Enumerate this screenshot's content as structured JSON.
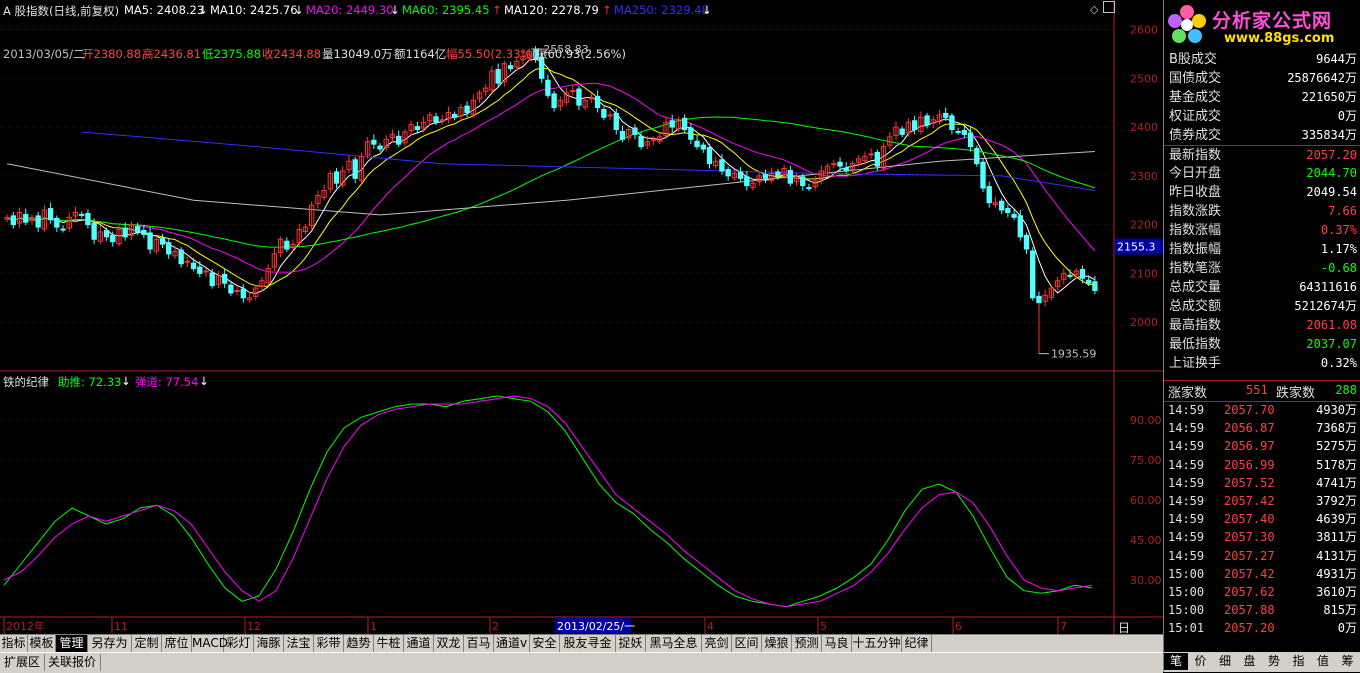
{
  "chart_title": "A 股指数(日线,前复权)",
  "ma_legend": [
    {
      "label": "MA5: 2408.23",
      "color": "#ffffff",
      "arrow": "↓",
      "arrow_color": "#ffffff"
    },
    {
      "label": "MA10: 2425.76",
      "color": "#ffffff",
      "arrow": "↓",
      "arrow_color": "#ffffff"
    },
    {
      "label": "MA20: 2449.30",
      "color": "#ff00ff",
      "arrow": "↓",
      "arrow_color": "#ffffff"
    },
    {
      "label": "MA60: 2395.45",
      "color": "#00ff00",
      "arrow": "↑",
      "arrow_color": "#ff3030"
    },
    {
      "label": "MA120: 2278.79",
      "color": "#ffffff",
      "arrow": "↑",
      "arrow_color": "#ff3030"
    },
    {
      "label": "MA250: 2329.48",
      "color": "#3030ff",
      "arrow": "↓",
      "arrow_color": "#ffffff"
    }
  ],
  "ohlc_info": {
    "date": "2013/03/05/二",
    "open": "开2380.88",
    "high": "高2436.81",
    "low": "低2375.88",
    "close": "收2434.88",
    "volume": "量13049.0万",
    "amount": "额1164亿",
    "change": "幅55.50(2.33%)",
    "amplitude": "振60.93(2.56%)"
  },
  "chart_data": [
    {
      "type": "candlestick",
      "title": "",
      "y_ticks": [
        2000,
        2100,
        2200,
        2300,
        2400,
        2500,
        2600
      ],
      "ylim": [
        1900,
        2640
      ],
      "x_ticks": [
        "2012年",
        "11",
        "12",
        "1",
        "2",
        "3",
        "4",
        "5",
        "6",
        "7"
      ],
      "current_price_label": "2155.3",
      "annotations": [
        {
          "text": "2558.83",
          "kind": "high"
        },
        {
          "text": "1935.59",
          "kind": "low"
        }
      ],
      "closes": [
        2215,
        2200,
        2225,
        2205,
        2215,
        2195,
        2230,
        2210,
        2195,
        2190,
        2215,
        2225,
        2220,
        2200,
        2170,
        2185,
        2175,
        2165,
        2190,
        2175,
        2200,
        2185,
        2180,
        2150,
        2170,
        2160,
        2140,
        2145,
        2120,
        2125,
        2110,
        2100,
        2105,
        2075,
        2095,
        2080,
        2060,
        2065,
        2050,
        2050,
        2070,
        2085,
        2110,
        2140,
        2170,
        2150,
        2160,
        2190,
        2195,
        2240,
        2260,
        2270,
        2305,
        2285,
        2310,
        2330,
        2295,
        2340,
        2370,
        2365,
        2355,
        2375,
        2385,
        2365,
        2390,
        2405,
        2395,
        2410,
        2425,
        2410,
        2415,
        2430,
        2420,
        2440,
        2430,
        2455,
        2470,
        2480,
        2515,
        2490,
        2530,
        2520,
        2535,
        2545,
        2555,
        2540,
        2500,
        2465,
        2440,
        2455,
        2470,
        2475,
        2445,
        2455,
        2460,
        2440,
        2420,
        2425,
        2395,
        2375,
        2395,
        2385,
        2360,
        2370,
        2375,
        2380,
        2410,
        2400,
        2415,
        2395,
        2375,
        2360,
        2355,
        2325,
        2330,
        2310,
        2300,
        2305,
        2295,
        2280,
        2285,
        2300,
        2295,
        2305,
        2300,
        2315,
        2285,
        2295,
        2280,
        2275,
        2290,
        2310,
        2320,
        2325,
        2320,
        2310,
        2325,
        2335,
        2340,
        2345,
        2320,
        2360,
        2380,
        2400,
        2385,
        2410,
        2395,
        2420,
        2405,
        2415,
        2425,
        2420,
        2395,
        2390,
        2385,
        2360,
        2325,
        2275,
        2245,
        2245,
        2230,
        2225,
        2215,
        2175,
        2150,
        2050,
        2040,
        2055,
        2070,
        2085,
        2100,
        2095,
        2105,
        2090,
        2080,
        2065
      ],
      "moving_averages": [
        {
          "name": "MA5",
          "color": "#ffffff"
        },
        {
          "name": "MA10",
          "color": "#ffff00"
        },
        {
          "name": "MA20",
          "color": "#ff00ff"
        },
        {
          "name": "MA60",
          "color": "#00ff00"
        },
        {
          "name": "MA120",
          "color": "#c0c0c0"
        },
        {
          "name": "MA250",
          "color": "#3030ff"
        }
      ]
    },
    {
      "type": "line",
      "title": "",
      "y_ticks": [
        30.0,
        45.0,
        60.0,
        75.0,
        90.0
      ],
      "ylim": [
        18,
        102
      ],
      "series": [
        {
          "name": "助推",
          "color": "#00ff00",
          "values": [
            28,
            36,
            44,
            52,
            57,
            54,
            51,
            53,
            57,
            58,
            54,
            46,
            36,
            27,
            22,
            24,
            34,
            48,
            64,
            78,
            87,
            91,
            93,
            95,
            96,
            96,
            95,
            97,
            98,
            99,
            98,
            97,
            93,
            86,
            76,
            66,
            59,
            55,
            49,
            44,
            38,
            33,
            28,
            24,
            22,
            21,
            20,
            22,
            24,
            27,
            31,
            36,
            45,
            56,
            64,
            66,
            63,
            54,
            42,
            31,
            26,
            25,
            26,
            28,
            27
          ]
        },
        {
          "name": "弹道",
          "color": "#ff00ff",
          "values": [
            30,
            33,
            39,
            46,
            51,
            54,
            52,
            54,
            56,
            58,
            56,
            51,
            42,
            33,
            26,
            22,
            26,
            38,
            53,
            68,
            80,
            88,
            92,
            94,
            95,
            96,
            96,
            96,
            97,
            98,
            99,
            98,
            95,
            89,
            80,
            71,
            62,
            57,
            52,
            47,
            41,
            36,
            31,
            26,
            23,
            21,
            20,
            21,
            22,
            25,
            28,
            33,
            40,
            49,
            57,
            62,
            63,
            59,
            50,
            39,
            30,
            27,
            26,
            27,
            28
          ]
        }
      ]
    }
  ],
  "indicator": {
    "name": "铁的纪律",
    "push_label": "助推: 72.33",
    "push_arrow": "↓",
    "trajectory_label": "弹道: 77.54",
    "trajectory_arrow": "↓"
  },
  "cursor_date": "2013/02/25/一",
  "period_label": "日线",
  "logo": {
    "title": "分析家公式网",
    "url": "www.88gs.com"
  },
  "stats": [
    {
      "label": "B股成交",
      "value": "9644万",
      "color": "#ffffff"
    },
    {
      "label": "国债成交",
      "value": "25876642万",
      "color": "#ffffff"
    },
    {
      "label": "基金成交",
      "value": "221650万",
      "color": "#ffffff"
    },
    {
      "label": "权证成交",
      "value": "0万",
      "color": "#ffffff"
    },
    {
      "label": "债券成交",
      "value": "335834万",
      "color": "#ffffff"
    },
    {
      "label": "最新指数",
      "value": "2057.20",
      "color": "#ff4040"
    },
    {
      "label": "今日开盘",
      "value": "2044.70",
      "color": "#00ff00"
    },
    {
      "label": "昨日收盘",
      "value": "2049.54",
      "color": "#ffffff"
    },
    {
      "label": "指数涨跌",
      "value": "7.66",
      "color": "#ff4040"
    },
    {
      "label": "指数涨幅",
      "value": "0.37%",
      "color": "#ff4040"
    },
    {
      "label": "指数振幅",
      "value": "1.17%",
      "color": "#ffffff"
    },
    {
      "label": "指数笔涨",
      "value": "-0.68",
      "color": "#00ff00"
    },
    {
      "label": "总成交量",
      "value": "64311616",
      "color": "#ffffff"
    },
    {
      "label": "总成交额",
      "value": "5212674万",
      "color": "#ffffff"
    },
    {
      "label": "最高指数",
      "value": "2061.08",
      "color": "#ff4040"
    },
    {
      "label": "最低指数",
      "value": "2037.07",
      "color": "#00ff00"
    },
    {
      "label": "上证换手",
      "value": "0.32%",
      "color": "#ffffff"
    }
  ],
  "advance_decline": {
    "up_label": "涨家数",
    "up_value": "551",
    "down_label": "跌家数",
    "down_value": "288"
  },
  "ticks": [
    {
      "time": "14:59",
      "price": "2057.70",
      "vol": "4930万"
    },
    {
      "time": "14:59",
      "price": "2056.87",
      "vol": "7368万"
    },
    {
      "time": "14:59",
      "price": "2056.97",
      "vol": "5275万"
    },
    {
      "time": "14:59",
      "price": "2056.99",
      "vol": "5178万"
    },
    {
      "time": "14:59",
      "price": "2057.52",
      "vol": "4741万"
    },
    {
      "time": "14:59",
      "price": "2057.42",
      "vol": "3792万"
    },
    {
      "time": "14:59",
      "price": "2057.40",
      "vol": "4639万"
    },
    {
      "time": "14:59",
      "price": "2057.30",
      "vol": "3811万"
    },
    {
      "time": "14:59",
      "price": "2057.27",
      "vol": "4131万"
    },
    {
      "time": "15:00",
      "price": "2057.42",
      "vol": "4931万"
    },
    {
      "time": "15:00",
      "price": "2057.62",
      "vol": "3610万"
    },
    {
      "time": "15:00",
      "price": "2057.88",
      "vol": "815万"
    },
    {
      "time": "15:01",
      "price": "2057.20",
      "vol": "0万"
    }
  ],
  "bottom_tabs": [
    "指标",
    "模板",
    "管理",
    "另存为",
    "定制",
    "席位",
    "MACD",
    "彩灯",
    "海豚",
    "法宝",
    "彩带",
    "趋势",
    "牛桩",
    "通道",
    "双龙",
    "百马",
    "通道v",
    "安全",
    "股友寻金",
    "捉妖",
    "黑马全息",
    "亮剑",
    "区间",
    "燥狼",
    "预测",
    "马良",
    "十五分钟",
    "纪律"
  ],
  "active_tab": "管理",
  "bottom_bar": [
    "扩展区",
    "关联报价"
  ],
  "right_tabs": [
    "笔",
    "价",
    "细",
    "盘",
    "势",
    "指",
    "值",
    "筹"
  ],
  "active_right_tab": "笔",
  "colors": {
    "up": "#ff3232",
    "down": "#54ffff",
    "axis": "#b02020",
    "text": "#c0c0c0"
  }
}
